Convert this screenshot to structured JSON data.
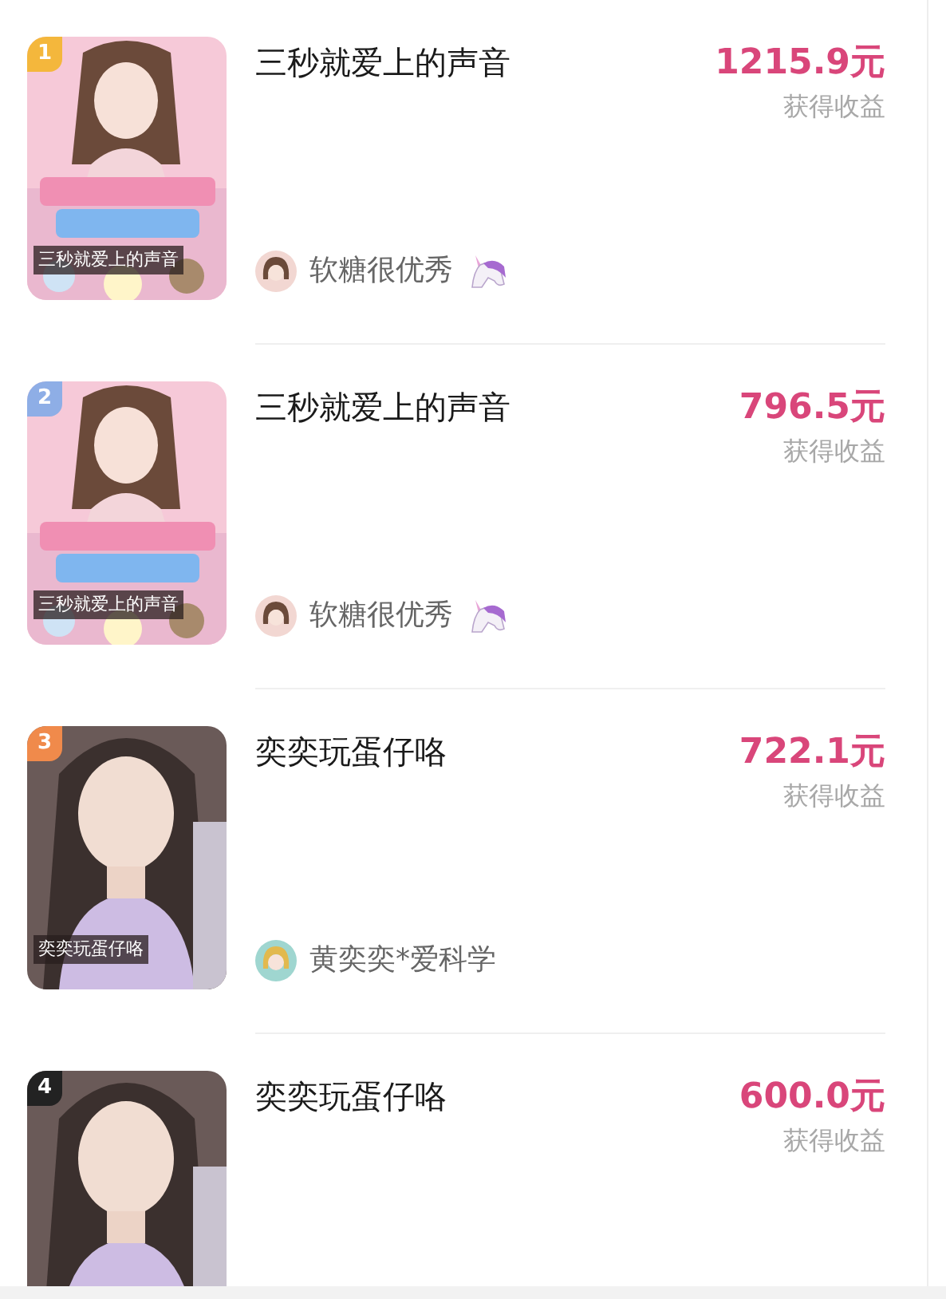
{
  "items": [
    {
      "rank": "1",
      "color": "#f4b73c",
      "kind": "pink",
      "caption": "三秒就爱上的声音",
      "title": "三秒就爱上的声音",
      "amount": "1215.9元",
      "amount_label": "获得收益",
      "author": {
        "name": "软糖很优秀",
        "kind": "pink",
        "emoji_badge": true
      }
    },
    {
      "rank": "2",
      "color": "#8eaee6",
      "kind": "pink",
      "caption": "三秒就爱上的声音",
      "title": "三秒就爱上的声音",
      "amount": "796.5元",
      "amount_label": "获得收益",
      "author": {
        "name": "软糖很优秀",
        "kind": "pink",
        "emoji_badge": true
      }
    },
    {
      "rank": "3",
      "color": "#f08a4b",
      "kind": "lilac",
      "caption": "奕奕玩蛋仔咯",
      "title": "奕奕玩蛋仔咯",
      "amount": "722.1元",
      "amount_label": "获得收益",
      "author": {
        "name": "黄奕奕*爱科学",
        "kind": "teal",
        "emoji_badge": false
      }
    },
    {
      "rank": "4",
      "color": "#222222",
      "kind": "lilac",
      "title": "奕奕玩蛋仔咯",
      "amount": "600.0元",
      "amount_label": "获得收益"
    }
  ]
}
